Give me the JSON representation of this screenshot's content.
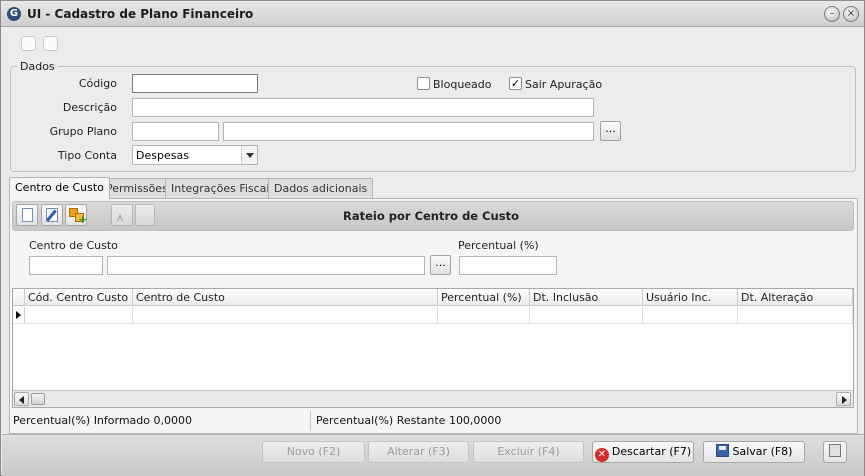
{
  "window": {
    "title": "UI - Cadastro de Plano Financeiro"
  },
  "dados": {
    "group_label": "Dados",
    "codigo_label": "Código",
    "codigo_value": "",
    "descricao_label": "Descrição",
    "descricao_value": "",
    "grupo_plano_label": "Grupo Plano",
    "grupo_plano_code": "",
    "grupo_plano_name": "",
    "tipo_conta_label": "Tipo Conta",
    "tipo_conta_value": "Despesas",
    "bloqueado_label": "Bloqueado",
    "bloqueado_checked": false,
    "sair_apuracao_label": "Sair Apuração",
    "sair_apuracao_checked": true,
    "ellipsis": "..."
  },
  "tabs": [
    {
      "label": "Centro de Custo",
      "active": true
    },
    {
      "label": "Permissões",
      "active": false
    },
    {
      "label": "Integrações Fiscais",
      "active": false
    },
    {
      "label": "Dados adicionais",
      "active": false
    }
  ],
  "rateio": {
    "toolbar_title": "Rateio por Centro de Custo",
    "centro_label": "Centro de Custo",
    "percentual_label": "Percentual (%)",
    "centro_code": "",
    "centro_name": "",
    "percentual_value": ""
  },
  "grid": {
    "columns": [
      "Cód. Centro Custo",
      "Centro de Custo",
      "Percentual (%)",
      "Dt. Inclusão",
      "Usuário Inc.",
      "Dt. Alteração"
    ],
    "rows": [
      [
        "",
        "",
        "",
        "",
        "",
        ""
      ]
    ]
  },
  "status": {
    "informado": "Percentual(%) Informado 0,0000",
    "restante": "Percentual(%) Restante 100,0000"
  },
  "buttons": {
    "novo": "Novo (F2)",
    "alterar": "Alterar (F3)",
    "excluir": "Excluir (F4)",
    "descartar": "Descartar (F7)",
    "salvar": "Salvar (F8)"
  },
  "colors": {
    "accent": "#d62b2b",
    "title_icon": "#2d4f7a"
  }
}
